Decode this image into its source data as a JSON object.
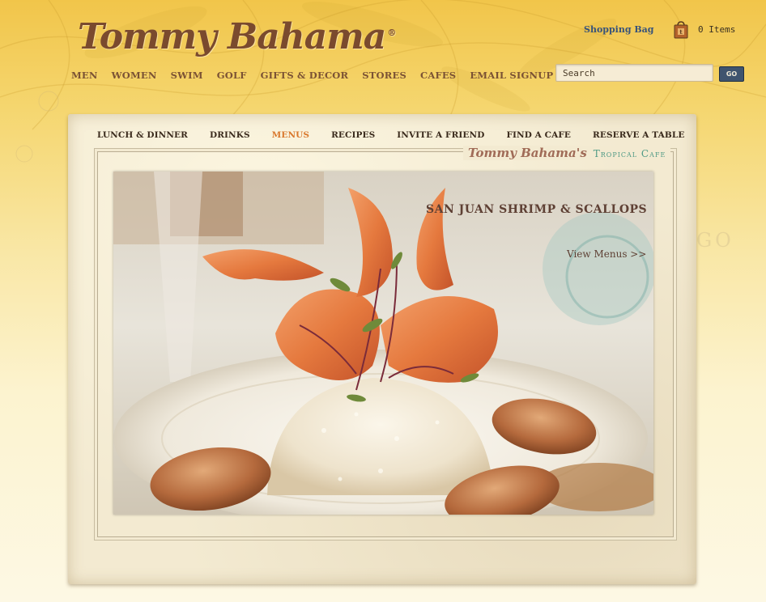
{
  "brand": {
    "logo_text": "Tommy Bahama",
    "registered": "®"
  },
  "header": {
    "nav": [
      "MEN",
      "WOMEN",
      "SWIM",
      "GOLF",
      "GIFTS & DECOR",
      "STORES",
      "CAFES",
      "EMAIL SIGNUP"
    ],
    "shopping_bag_label": "Shopping Bag",
    "bag_icon": "shopping-bag-icon",
    "items_count": "0 Items",
    "search": {
      "value": "Search",
      "button_label": "GO"
    }
  },
  "cafe": {
    "subnav": [
      "LUNCH & DINNER",
      "DRINKS",
      "MENUS",
      "RECIPES",
      "INVITE A FRIEND",
      "FIND A CAFE",
      "RESERVE A TABLE"
    ],
    "active_subnav": "MENUS",
    "brand_script": "Tommy Bahama's",
    "brand_tag": "Tropical Cafe"
  },
  "feature": {
    "title": "SAN JUAN SHRIMP & SCALLOPS",
    "link_label": "View Menus >>"
  },
  "colors": {
    "active": "#d9772c",
    "link_blue": "#38537a",
    "brown": "#7b5234",
    "teal": "#4f9a85"
  }
}
